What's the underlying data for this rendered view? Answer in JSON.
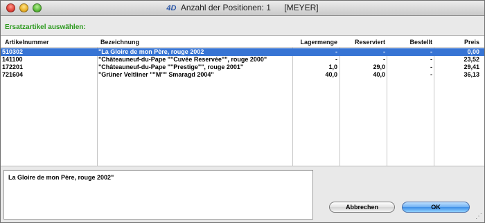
{
  "window": {
    "title_logo": "4D",
    "title": "Anzahl der Positionen: 1",
    "user": "[MEYER]"
  },
  "section_label": "Ersatzartikel auswählen:",
  "table": {
    "columns": [
      "Artikelnummer",
      "Bezeichnung",
      "Lagermenge",
      "Reserviert",
      "Bestellt",
      "Preis"
    ],
    "rows": [
      [
        "510302",
        "\"La Gloire de mon Père, rouge 2002",
        "-",
        "-",
        "-",
        "0,00"
      ],
      [
        "141100",
        "\"Châteauneuf-du-Pape \"\"Cuvée Reservée\"\", rouge 2000\"",
        "-",
        "-",
        "-",
        "23,52"
      ],
      [
        "172201",
        "\"Châteauneuf-du-Pape \"\"Prestige\"\", rouge 2001\"",
        "1,0",
        "29,0",
        "-",
        "29,41"
      ],
      [
        "721604",
        "\"Grüner Veltliner \"\"M\"\" Smaragd 2004\"",
        "40,0",
        "40,0",
        "-",
        "36,13"
      ]
    ],
    "selected_row": 0
  },
  "detail_text": "La Gloire de mon Père, rouge 2002\"",
  "buttons": {
    "cancel": "Abbrechen",
    "ok": "OK"
  },
  "colors": {
    "selection": "#3774d4",
    "section_label": "#2d9a1f"
  }
}
